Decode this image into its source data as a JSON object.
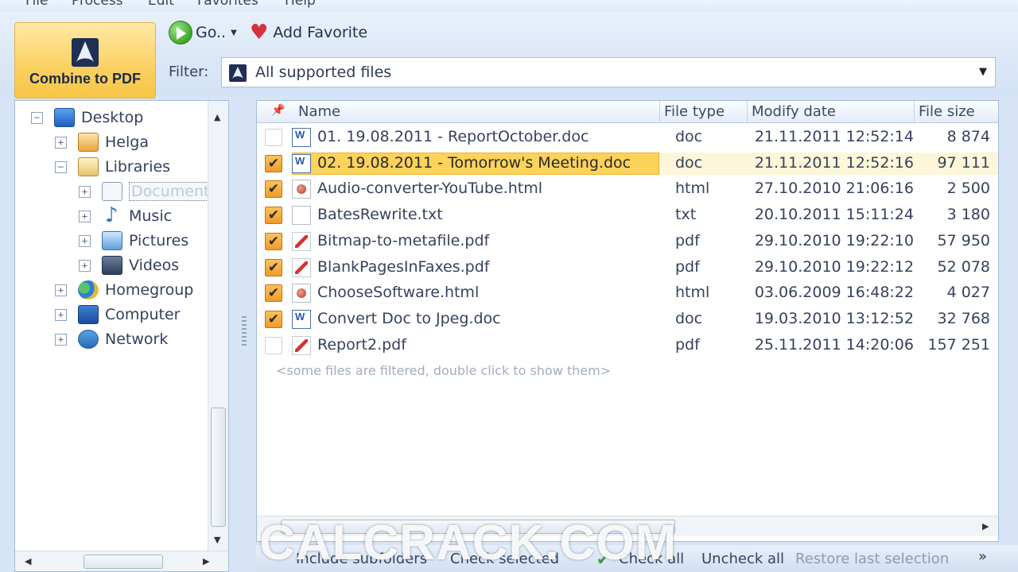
{
  "menu": [
    "File",
    "Process",
    "Edit",
    "Favorites",
    "Help"
  ],
  "toolbar": {
    "combine_label": "Combine to PDF",
    "go_label": "Go..",
    "add_favorite_label": "Add Favorite",
    "filter_label": "Filter:",
    "filter_value": "All supported files"
  },
  "tree": [
    {
      "label": "Desktop",
      "expander": "−",
      "icon": "desktop-icon"
    },
    {
      "label": "Helga",
      "expander": "+",
      "icon": "user-folder-icon"
    },
    {
      "label": "Libraries",
      "expander": "−",
      "icon": "libraries-icon"
    },
    {
      "label": "Documents",
      "expander": "+",
      "icon": "documents-icon"
    },
    {
      "label": "Music",
      "expander": "+",
      "icon": "music-icon"
    },
    {
      "label": "Pictures",
      "expander": "+",
      "icon": "pictures-icon"
    },
    {
      "label": "Videos",
      "expander": "+",
      "icon": "videos-icon"
    },
    {
      "label": "Homegroup",
      "expander": "+",
      "icon": "homegroup-icon"
    },
    {
      "label": "Computer",
      "expander": "+",
      "icon": "computer-icon"
    },
    {
      "label": "Network",
      "expander": "+",
      "icon": "network-icon"
    }
  ],
  "columns": {
    "name": "Name",
    "type": "File type",
    "date": "Modify date",
    "size": "File size"
  },
  "files": [
    {
      "checked": false,
      "icon": "doc",
      "name": "01. 19.08.2011 - ReportOctober.doc",
      "type": "doc",
      "date": "21.11.2011 12:52:14",
      "size": "8 874"
    },
    {
      "checked": true,
      "icon": "doc",
      "name": "02. 19.08.2011 - Tomorrow's Meeting.doc",
      "type": "doc",
      "date": "21.11.2011 12:52:16",
      "size": "97 111"
    },
    {
      "checked": true,
      "icon": "html",
      "name": "Audio-converter-YouTube.html",
      "type": "html",
      "date": "27.10.2010 21:06:16",
      "size": "2 500"
    },
    {
      "checked": true,
      "icon": "txt",
      "name": "BatesRewrite.txt",
      "type": "txt",
      "date": "20.10.2011 15:11:24",
      "size": "3 180"
    },
    {
      "checked": true,
      "icon": "pdf",
      "name": "Bitmap-to-metafile.pdf",
      "type": "pdf",
      "date": "29.10.2010 19:22:10",
      "size": "57 950"
    },
    {
      "checked": true,
      "icon": "pdf",
      "name": "BlankPagesInFaxes.pdf",
      "type": "pdf",
      "date": "29.10.2010 19:22:12",
      "size": "52 078"
    },
    {
      "checked": true,
      "icon": "html",
      "name": "ChooseSoftware.html",
      "type": "html",
      "date": "03.06.2009 16:48:22",
      "size": "4 027"
    },
    {
      "checked": true,
      "icon": "doc",
      "name": "Convert Doc to Jpeg.doc",
      "type": "doc",
      "date": "19.03.2010 13:12:52",
      "size": "32 768"
    },
    {
      "checked": false,
      "icon": "pdf",
      "name": "Report2.pdf",
      "type": "pdf",
      "date": "25.11.2011 14:20:06",
      "size": "157 251"
    }
  ],
  "filtered_note": "<some files are filtered, double click to show them>",
  "bottom": {
    "include_subfolders": "Include subfolders",
    "check_selected": "Check selected",
    "check_all": "Check all",
    "uncheck_all": "Uncheck all",
    "restore": "Restore last selection"
  },
  "watermark": "CALCRACK.COM",
  "colors": {
    "highlight": "#fbd25a",
    "checkbox": "#ef9b2a",
    "accent": "#1f5fbf"
  }
}
